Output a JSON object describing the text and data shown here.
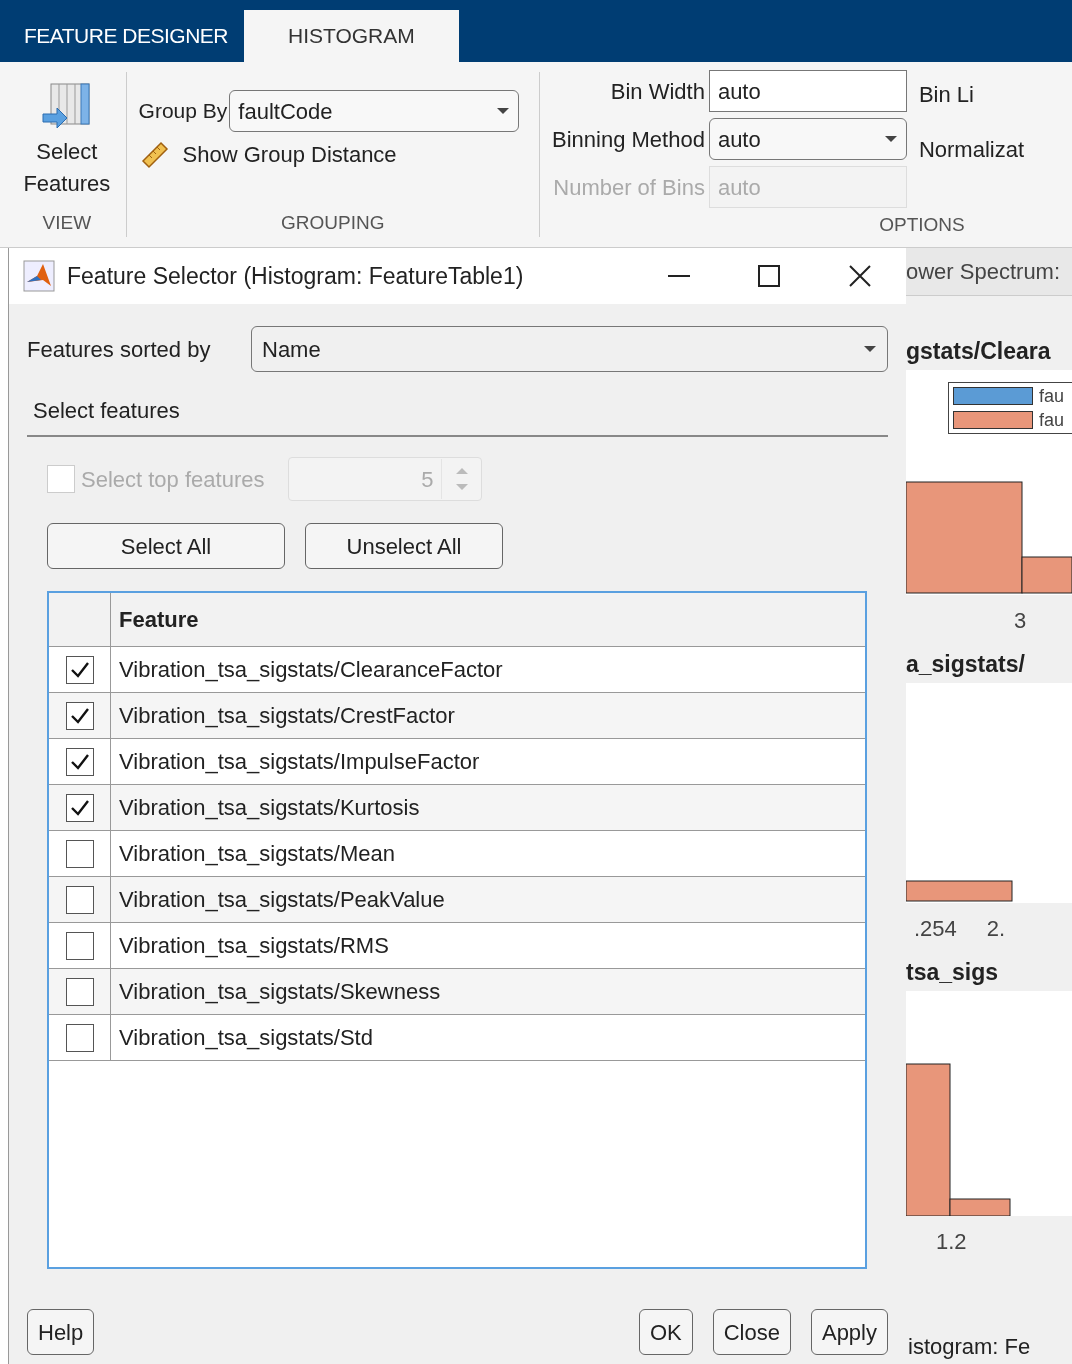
{
  "ribbon": {
    "tabs": [
      {
        "label": "FEATURE DESIGNER",
        "selected": false
      },
      {
        "label": "HISTOGRAM",
        "selected": true
      }
    ],
    "view": {
      "button": "Select Features",
      "section": "VIEW"
    },
    "grouping": {
      "group_by_label": "Group By",
      "group_by_value": "faultCode",
      "show_distance": "Show Group Distance",
      "section": "GROUPING"
    },
    "options": {
      "fields": [
        {
          "label": "Bin Width",
          "value": "auto",
          "kind": "text",
          "disabled": false
        },
        {
          "label": "Binning Method",
          "value": "auto",
          "kind": "dropdown",
          "disabled": false
        },
        {
          "label": "Number of Bins",
          "value": "auto",
          "kind": "text",
          "disabled": true
        }
      ],
      "right_labels": [
        "Bin Li",
        "Normalizat"
      ],
      "section": "OPTIONS"
    }
  },
  "dialog": {
    "title": "Feature Selector (Histogram: FeatureTable1)",
    "sorted_by_label": "Features sorted by",
    "sorted_by_value": "Name",
    "section": "Select features",
    "top_features": {
      "label": "Select top features",
      "checked": false,
      "disabled": true,
      "value": "5"
    },
    "buttons": [
      "Select All",
      "Unselect All"
    ],
    "table": {
      "column": "Feature",
      "rows": [
        {
          "name": "Vibration_tsa_sigstats/ClearanceFactor",
          "checked": true
        },
        {
          "name": "Vibration_tsa_sigstats/CrestFactor",
          "checked": true
        },
        {
          "name": "Vibration_tsa_sigstats/ImpulseFactor",
          "checked": true
        },
        {
          "name": "Vibration_tsa_sigstats/Kurtosis",
          "checked": true
        },
        {
          "name": "Vibration_tsa_sigstats/Mean",
          "checked": false
        },
        {
          "name": "Vibration_tsa_sigstats/PeakValue",
          "checked": false
        },
        {
          "name": "Vibration_tsa_sigstats/RMS",
          "checked": false
        },
        {
          "name": "Vibration_tsa_sigstats/Skewness",
          "checked": false
        },
        {
          "name": "Vibration_tsa_sigstats/Std",
          "checked": false
        }
      ]
    },
    "footer_left": "Help",
    "footer_buttons": [
      "OK",
      "Close",
      "Apply"
    ]
  },
  "background": {
    "tab": "ower Spectrum:",
    "plots": [
      {
        "title": "gstats/Cleara",
        "legend": [
          {
            "label": "fau",
            "color": "#5b9bd5"
          },
          {
            "label": "fau",
            "color": "#e8967a"
          }
        ],
        "ticks": [
          "3"
        ]
      },
      {
        "title": "a_sigstats/",
        "ticks": [
          ".254",
          "2."
        ]
      },
      {
        "title": "tsa_sigs",
        "ticks": [
          "1.2"
        ]
      }
    ],
    "status": "istogram: Fe"
  }
}
